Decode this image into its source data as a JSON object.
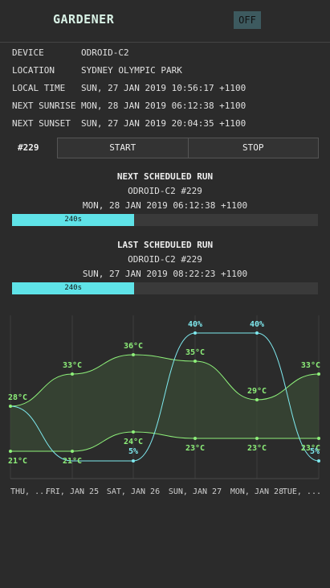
{
  "header": {
    "title": "GARDENER",
    "toggle_label": "OFF"
  },
  "info": [
    {
      "key": "DEVICE",
      "value": "ODROID-C2"
    },
    {
      "key": "LOCATION",
      "value": "SYDNEY OLYMPIC PARK"
    },
    {
      "key": "LOCAL TIME",
      "value": "SUN, 27 JAN 2019 10:56:17 +1100"
    },
    {
      "key": "NEXT SUNRISE",
      "value": "MON, 28 JAN 2019 06:12:38 +1100"
    },
    {
      "key": "NEXT SUNSET",
      "value": "SUN, 27 JAN 2019 20:04:35 +1100"
    }
  ],
  "controls": {
    "run_id": "#229",
    "start_label": "START",
    "stop_label": "STOP"
  },
  "next_run": {
    "title": "NEXT SCHEDULED RUN",
    "device": "ODROID-C2 #229",
    "time": "MON, 28 JAN 2019 06:12:38 +1100",
    "duration_label": "240s",
    "progress_fraction": 0.4
  },
  "last_run": {
    "title": "LAST SCHEDULED RUN",
    "device": "ODROID-C2 #229",
    "time": "SUN, 27 JAN 2019 08:22:23 +1100",
    "duration_label": "240s",
    "progress_fraction": 0.4
  },
  "colors": {
    "temp": "#8ef07a",
    "rain": "#7ee8ee",
    "bar": "#5fe3e8",
    "band": "#3a4a36"
  },
  "chart_data": {
    "type": "line",
    "categories": [
      "THU, ...",
      "FRI, JAN 25",
      "SAT, JAN 26",
      "SUN, JAN 27",
      "MON, JAN 28",
      "TUE, ..."
    ],
    "series": [
      {
        "values": [
          28,
          33,
          36,
          35,
          29,
          33
        ],
        "labels": [
          "28°C",
          "33°C",
          "36°C",
          "35°C",
          "29°C",
          "33°C"
        ]
      },
      {
        "values": [
          21,
          21,
          24,
          23,
          23,
          23
        ],
        "labels": [
          "21°C",
          "21°C",
          "24°C",
          "23°C",
          "23°C",
          "23°C"
        ]
      },
      {
        "values": [
          null,
          null,
          5,
          40,
          40,
          5
        ],
        "labels": [
          "",
          "",
          "5%",
          "40%",
          "40%",
          "5%"
        ]
      }
    ],
    "grid": true
  }
}
